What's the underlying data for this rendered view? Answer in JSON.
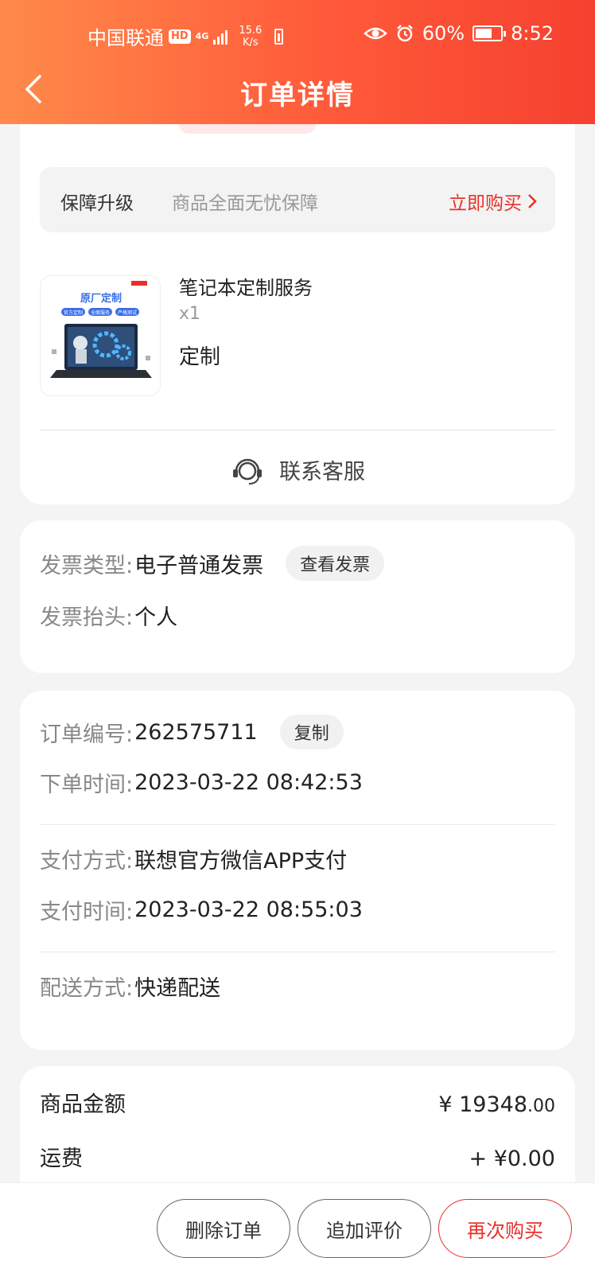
{
  "status_bar": {
    "carrier": "中国联通",
    "hd": "HD",
    "network": "4G",
    "speed_top": "15.6",
    "speed_bottom": "K/s",
    "battery_percent": "60%",
    "time": "8:52"
  },
  "nav": {
    "title": "订单详情"
  },
  "protection": {
    "label": "保障升级",
    "desc": "商品全面无忧保障",
    "action": "立即购买"
  },
  "product": {
    "image_text": "原厂定制",
    "image_tags": [
      "官方定制",
      "全面服务",
      "严格测试"
    ],
    "name": "笔记本定制服务",
    "qty": "x1",
    "type": "定制"
  },
  "service": {
    "label": "联系客服"
  },
  "invoice": {
    "type_label": "发票类型:",
    "type_value": "电子普通发票",
    "view_button": "查看发票",
    "title_label": "发票抬头:",
    "title_value": "个人"
  },
  "order": {
    "number_label": "订单编号:",
    "number_value": "262575711",
    "copy_button": "复制",
    "time_label": "下单时间:",
    "time_value": "2023-03-22 08:42:53",
    "pay_method_label": "支付方式:",
    "pay_method_value": "联想官方微信APP支付",
    "pay_time_label": "支付时间:",
    "pay_time_value": "2023-03-22 08:55:03",
    "delivery_label": "配送方式:",
    "delivery_value": "快递配送"
  },
  "amount": {
    "goods_label": "商品金额",
    "goods_value_main": "¥ 19348",
    "goods_value_dec": ".00",
    "shipping_label": "运费",
    "shipping_value": "+ ¥0.00"
  },
  "actions": {
    "delete": "删除订单",
    "review": "追加评价",
    "rebuy": "再次购买"
  },
  "colors": {
    "header_start": "#ff8a4a",
    "header_end": "#f5412f",
    "accent_red": "#e8302a"
  }
}
